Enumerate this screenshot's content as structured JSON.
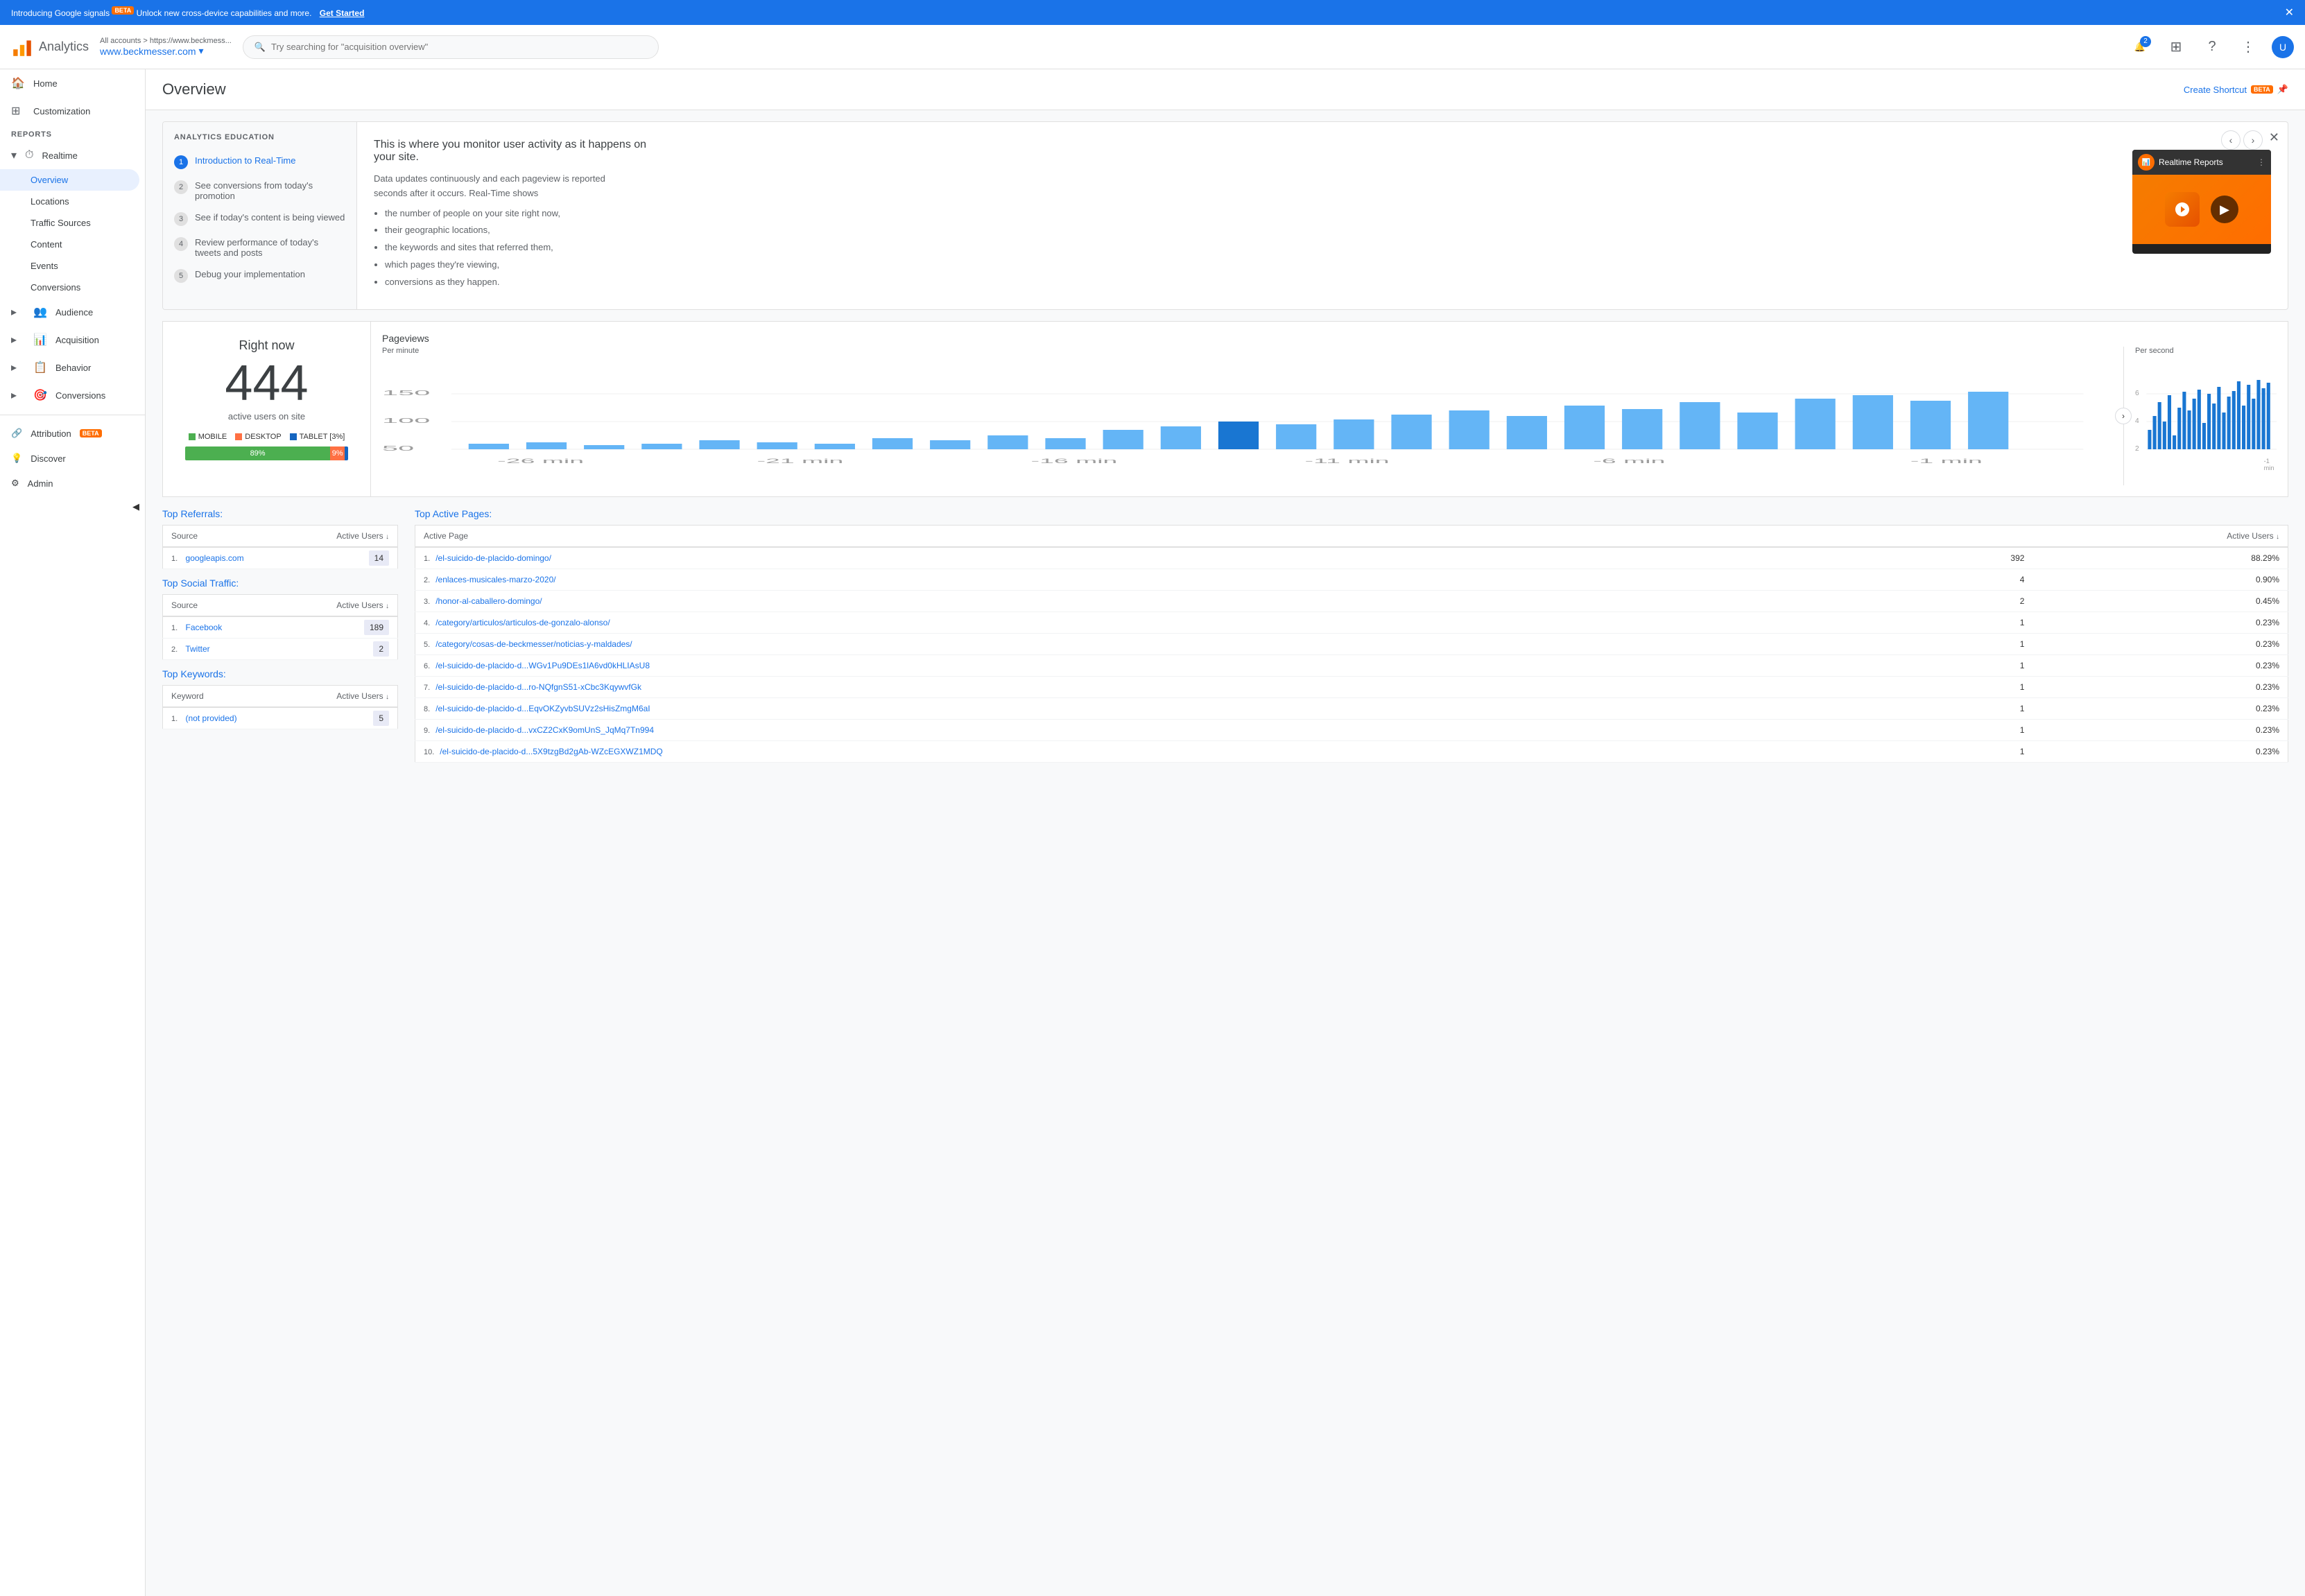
{
  "banner": {
    "text": "Introducing Google signals",
    "beta": "BETA",
    "subtext": "Unlock new cross-device capabilities and more.",
    "cta": "Get Started"
  },
  "header": {
    "logo_text": "Analytics",
    "all_accounts": "All accounts > https://www.beckmess...",
    "site_name": "www.beckmesser.com",
    "search_placeholder": "Try searching for \"acquisition overview\"",
    "notif_count": "2"
  },
  "sidebar": {
    "home": "Home",
    "customization": "Customization",
    "reports_label": "REPORTS",
    "realtime": "Realtime",
    "overview": "Overview",
    "locations": "Locations",
    "traffic_sources": "Traffic Sources",
    "content": "Content",
    "events": "Events",
    "conversions": "Conversions",
    "audience": "Audience",
    "acquisition": "Acquisition",
    "behavior": "Behavior",
    "conversions2": "Conversions",
    "attribution": "Attribution",
    "attribution_beta": "BETA",
    "discover": "Discover",
    "admin": "Admin"
  },
  "page": {
    "title": "Overview",
    "create_shortcut": "Create Shortcut",
    "beta": "BETA"
  },
  "education": {
    "section_label": "ANALYTICS EDUCATION",
    "steps": [
      {
        "num": "1",
        "text": "Introduction to Real-Time",
        "active": true
      },
      {
        "num": "2",
        "text": "See conversions from today's promotion",
        "active": false
      },
      {
        "num": "3",
        "text": "See if today's content is being viewed",
        "active": false
      },
      {
        "num": "4",
        "text": "Review performance of today's tweets and posts",
        "active": false
      },
      {
        "num": "5",
        "text": "Debug your implementation",
        "active": false
      }
    ],
    "title": "This is where you monitor user activity as it happens on your site.",
    "description": "Data updates continuously and each pageview is reported seconds after it occurs. Real-Time shows",
    "bullets": [
      "the number of people on your site right now,",
      "their geographic locations,",
      "the keywords and sites that referred them,",
      "which pages they're viewing,",
      "conversions as they happen."
    ],
    "video_title": "Realtime Reports"
  },
  "stats": {
    "right_now_label": "Right now",
    "active_count": "444",
    "active_label": "active users on site",
    "mobile_label": "MOBILE",
    "desktop_label": "DESKTOP",
    "tablet_label": "TABLET [3%]",
    "mobile_pct": "89%",
    "desktop_pct": "9%"
  },
  "charts": {
    "pageviews_label": "Pageviews",
    "per_minute_label": "Per minute",
    "per_second_label": "Per second",
    "x_labels": [
      "-26 min",
      "-21 min",
      "-16 min",
      "-11 min",
      "-6 min",
      "-1 min"
    ],
    "y_labels": [
      "50",
      "100",
      "150"
    ],
    "y2_labels": [
      "2",
      "4",
      "6"
    ]
  },
  "top_referrals": {
    "title": "Top Referrals:",
    "source_col": "Source",
    "users_col": "Active Users",
    "rows": [
      {
        "num": "1.",
        "source": "googleapis.com",
        "users": "14"
      }
    ]
  },
  "top_social": {
    "title": "Top Social Traffic:",
    "source_col": "Source",
    "users_col": "Active Users",
    "rows": [
      {
        "num": "1.",
        "source": "Facebook",
        "users": "189"
      },
      {
        "num": "2.",
        "source": "Twitter",
        "users": "2"
      }
    ]
  },
  "top_keywords": {
    "title": "Top Keywords:",
    "keyword_col": "Keyword",
    "users_col": "Active Users",
    "rows": [
      {
        "num": "1.",
        "keyword": "(not provided)",
        "users": "5"
      }
    ]
  },
  "top_pages": {
    "title": "Top Active Pages:",
    "page_col": "Active Page",
    "users_col": "Active Users",
    "rows": [
      {
        "num": "1.",
        "page": "/el-suicido-de-placido-domingo/",
        "users": "392",
        "pct": "88.29%"
      },
      {
        "num": "2.",
        "page": "/enlaces-musicales-marzo-2020/",
        "users": "4",
        "pct": "0.90%"
      },
      {
        "num": "3.",
        "page": "/honor-al-caballero-domingo/",
        "users": "2",
        "pct": "0.45%"
      },
      {
        "num": "4.",
        "page": "/category/articulos/articulos-de-gonzalo-alonso/",
        "users": "1",
        "pct": "0.23%"
      },
      {
        "num": "5.",
        "page": "/category/cosas-de-beckmesser/noticias-y-maldades/",
        "users": "1",
        "pct": "0.23%"
      },
      {
        "num": "6.",
        "page": "/el-suicido-de-placido-d...WGv1Pu9DEs1lA6vd0kHLIAsU8",
        "users": "1",
        "pct": "0.23%"
      },
      {
        "num": "7.",
        "page": "/el-suicido-de-placido-d...ro-NQfgnS51-xCbc3KqywvfGk",
        "users": "1",
        "pct": "0.23%"
      },
      {
        "num": "8.",
        "page": "/el-suicido-de-placido-d...EqvOKZyvbSUVz2sHisZmgM6aI",
        "users": "1",
        "pct": "0.23%"
      },
      {
        "num": "9.",
        "page": "/el-suicido-de-placido-d...vxCZ2CxK9omUnS_JqMq7Tn994",
        "users": "1",
        "pct": "0.23%"
      },
      {
        "num": "10.",
        "page": "/el-suicido-de-placido-d...5X9tzgBd2gAb-WZcEGXWZ1MDQ",
        "users": "1",
        "pct": "0.23%"
      }
    ]
  }
}
